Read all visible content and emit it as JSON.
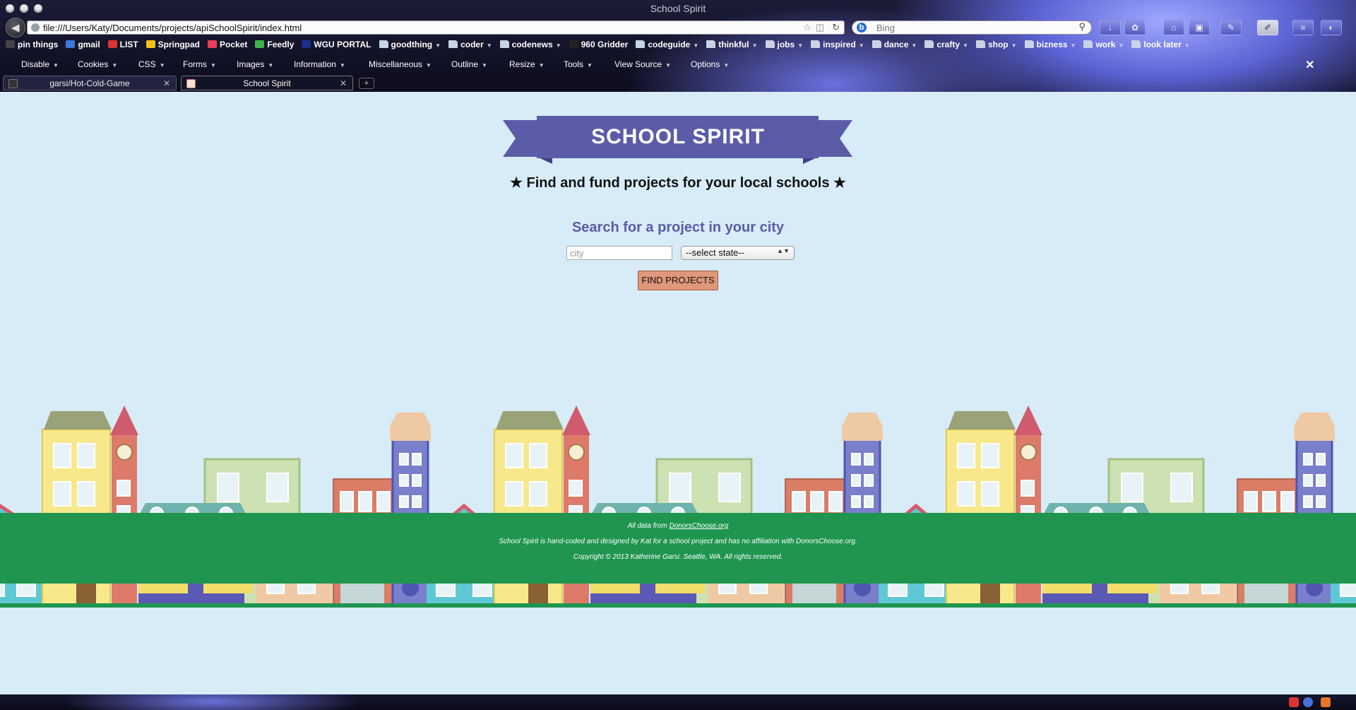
{
  "window": {
    "title": "School Spirit"
  },
  "navbar": {
    "url": "file:///Users/Katy/Documents/projects/apiSchoolSpirit/index.html",
    "search_placeholder": "Bing"
  },
  "bookmarks": [
    {
      "label": "pin things",
      "icon": "pin-icon",
      "folder": false
    },
    {
      "label": "gmail",
      "icon": "google-icon",
      "folder": false
    },
    {
      "label": "LIST",
      "icon": "list-icon",
      "folder": false
    },
    {
      "label": "Springpad",
      "icon": "springpad-icon",
      "folder": false
    },
    {
      "label": "Pocket",
      "icon": "pocket-icon",
      "folder": false
    },
    {
      "label": "Feedly",
      "icon": "feedly-icon",
      "folder": false
    },
    {
      "label": "WGU PORTAL",
      "icon": "wgu-icon",
      "folder": false
    },
    {
      "label": "goodthing",
      "icon": "folder-icon",
      "folder": true
    },
    {
      "label": "coder",
      "icon": "folder-icon",
      "folder": true
    },
    {
      "label": "codenews",
      "icon": "folder-icon",
      "folder": true
    },
    {
      "label": "960 Gridder",
      "icon": "grid-icon",
      "folder": false
    },
    {
      "label": "codeguide",
      "icon": "folder-icon",
      "folder": true
    },
    {
      "label": "thinkful",
      "icon": "folder-icon",
      "folder": true
    },
    {
      "label": "jobs",
      "icon": "folder-icon",
      "folder": true
    },
    {
      "label": "inspired",
      "icon": "folder-icon",
      "folder": true
    },
    {
      "label": "dance",
      "icon": "folder-icon",
      "folder": true
    },
    {
      "label": "crafty",
      "icon": "folder-icon",
      "folder": true
    },
    {
      "label": "shop",
      "icon": "folder-icon",
      "folder": true
    },
    {
      "label": "bizness",
      "icon": "folder-icon",
      "folder": true
    },
    {
      "label": "work",
      "icon": "folder-icon",
      "folder": true
    },
    {
      "label": "look later",
      "icon": "folder-icon",
      "folder": true
    }
  ],
  "devtoolbar": [
    "Disable",
    "Cookies",
    "CSS",
    "Forms",
    "Images",
    "Information",
    "Miscellaneous",
    "Outline",
    "Resize",
    "Tools",
    "View Source",
    "Options"
  ],
  "tabs": [
    {
      "label": "garsi/Hot-Cold-Game",
      "active": false
    },
    {
      "label": "School Spirit",
      "active": true
    }
  ],
  "page": {
    "banner_title": "SCHOOL SPIRIT",
    "tagline": "★ Find and fund projects for your local schools ★",
    "search_heading": "Search for a project in your city",
    "city_placeholder": "city",
    "state_select_value": "--select state--",
    "find_button": "FIND PROJECTS",
    "footer": {
      "data_prefix": "All data from ",
      "data_link": "DonorsChoose.org",
      "disclaimer": "School Spirit is hand-coded and designed by Kat for a school project and has no affiliation with DonorsChoose.org.",
      "copyright": "Copyright © 2013 Katherine Garsi. Seattle, WA. All rights reserved."
    }
  },
  "colors": {
    "page_bg": "#d7ecf7",
    "banner": "#5b5ca8",
    "banner_dark": "#3f4088",
    "footer": "#1f9550",
    "button": "#e0977a"
  }
}
